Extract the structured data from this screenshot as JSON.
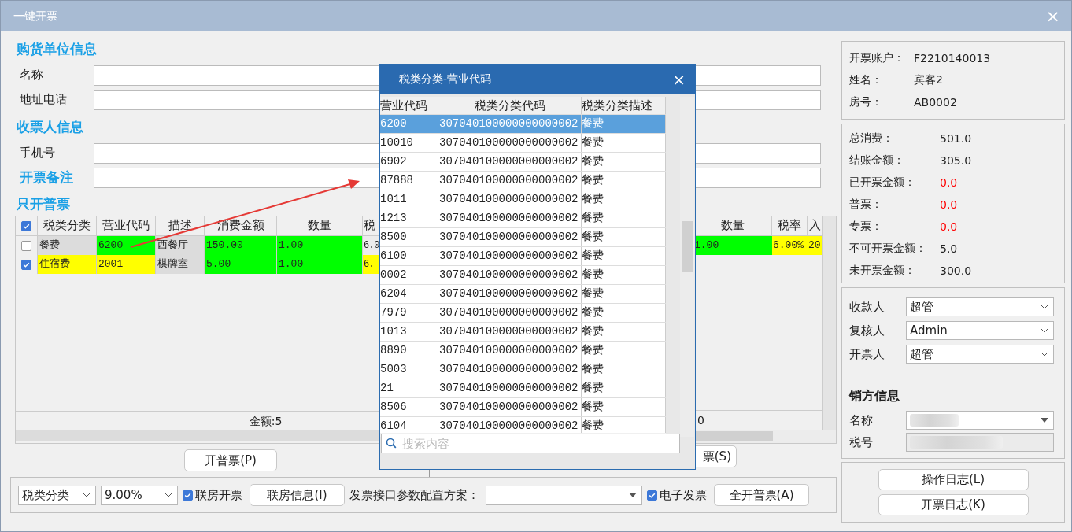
{
  "window": {
    "title": "一键开票",
    "close": "×"
  },
  "buyer": {
    "heading": "购货单位信息",
    "fields": [
      {
        "label": "名称"
      },
      {
        "label": "地址电话"
      }
    ]
  },
  "recipient": {
    "heading": "收票人信息",
    "fields": [
      {
        "label": "手机号"
      }
    ],
    "remark_label": "开票备注"
  },
  "normal_invoice": {
    "heading": "只开普票",
    "header_checked": true,
    "columns": [
      "税类分类",
      "营业代码",
      "描述",
      "消费金额",
      "数量",
      "税"
    ],
    "rows": [
      {
        "checked": false,
        "cells": [
          {
            "text": "餐费",
            "color": "#dcdcdc"
          },
          {
            "text": "6200",
            "color": "#00ff00"
          },
          {
            "text": "西餐厅",
            "color": "#dcdcdc"
          },
          {
            "text": "150.00",
            "color": "#00ff00"
          },
          {
            "text": "1.00",
            "color": "#00ff00"
          },
          {
            "text": "6.0",
            "color": "#ececec"
          }
        ]
      },
      {
        "checked": true,
        "cells": [
          {
            "text": "住宿费",
            "color": "#ffff00"
          },
          {
            "text": "2001",
            "color": "#ffff00"
          },
          {
            "text": "棋牌室",
            "color": "#dcdcdc"
          },
          {
            "text": "5.00",
            "color": "#00ff00"
          },
          {
            "text": "1.00",
            "color": "#00ff00"
          },
          {
            "text": "6.",
            "color": "#ffff00"
          }
        ]
      }
    ],
    "total": "金额:5",
    "button": "开普票(P)"
  },
  "special_invoice": {
    "columns": [
      "数量",
      "税率",
      "入"
    ],
    "rows": [
      {
        "cells": [
          {
            "text": "1.00",
            "color": "#00ff00"
          },
          {
            "text": "6.00%",
            "color": "#ffff00"
          },
          {
            "text": "20",
            "color": "#ffff00"
          }
        ]
      }
    ],
    "total": "0",
    "button": "票(S)"
  },
  "toolbar": {
    "category": "税类分类",
    "rate": "9.00%",
    "link_room": {
      "label": "联房开票",
      "checked": true
    },
    "link_info_button": "联房信息(I)",
    "scheme_label": "发票接口参数配置方案：",
    "electronic": {
      "label": "电子发票",
      "checked": true
    },
    "all_button": "全开普票(A)"
  },
  "account": [
    {
      "label": "开票账户：",
      "value": "F2210140013"
    },
    {
      "label": "姓名：",
      "value": "宾客2"
    },
    {
      "label": "房号：",
      "value": "AB0002"
    }
  ],
  "totals": [
    {
      "label": "总消费：",
      "value": "501.0",
      "kind": "normal"
    },
    {
      "label": "结账金额：",
      "value": "305.0",
      "kind": "normal"
    },
    {
      "label": "已开票金额：",
      "value": "0.0",
      "kind": "alert"
    },
    {
      "label": "普票：",
      "value": "0.0",
      "kind": "alert"
    },
    {
      "label": "专票：",
      "value": "0.0",
      "kind": "alert"
    },
    {
      "label": "不可开票金额：",
      "value": "5.0",
      "kind": "normal"
    },
    {
      "label": "未开票金额：",
      "value": "300.0",
      "kind": "normal"
    }
  ],
  "signers": [
    {
      "label": "收款人",
      "value": "超管"
    },
    {
      "label": "复核人",
      "value": "Admin"
    },
    {
      "label": "开票人",
      "value": "超管"
    }
  ],
  "seller": {
    "heading": "销方信息",
    "fields": [
      {
        "label": "名称",
        "kind": "dropdown"
      },
      {
        "label": "税号",
        "kind": "readonly"
      }
    ]
  },
  "log_buttons": [
    "操作日志(L)",
    "开票日志(K)"
  ],
  "dialog": {
    "title": "税类分类-营业代码",
    "close": "×",
    "columns": [
      "营业代码",
      "税类分类代码",
      "税类分类描述"
    ],
    "rows": [
      {
        "code": "6200",
        "tax_code": "307040100000000000002",
        "desc": "餐费",
        "selected": true
      },
      {
        "code": "10010",
        "tax_code": "307040100000000000002",
        "desc": "餐费",
        "selected": false
      },
      {
        "code": "6902",
        "tax_code": "307040100000000000002",
        "desc": "餐费",
        "selected": false
      },
      {
        "code": "87888",
        "tax_code": "307040100000000000002",
        "desc": "餐费",
        "selected": false
      },
      {
        "code": "1011",
        "tax_code": "307040100000000000002",
        "desc": "餐费",
        "selected": false
      },
      {
        "code": "1213",
        "tax_code": "307040100000000000002",
        "desc": "餐费",
        "selected": false
      },
      {
        "code": "8500",
        "tax_code": "307040100000000000002",
        "desc": "餐费",
        "selected": false
      },
      {
        "code": "6100",
        "tax_code": "307040100000000000002",
        "desc": "餐费",
        "selected": false
      },
      {
        "code": "0002",
        "tax_code": "307040100000000000002",
        "desc": "餐费",
        "selected": false
      },
      {
        "code": "6204",
        "tax_code": "307040100000000000002",
        "desc": "餐费",
        "selected": false
      },
      {
        "code": "7979",
        "tax_code": "307040100000000000002",
        "desc": "餐费",
        "selected": false
      },
      {
        "code": "1013",
        "tax_code": "307040100000000000002",
        "desc": "餐费",
        "selected": false
      },
      {
        "code": "8890",
        "tax_code": "307040100000000000002",
        "desc": "餐费",
        "selected": false
      },
      {
        "code": "5003",
        "tax_code": "307040100000000000002",
        "desc": "餐费",
        "selected": false
      },
      {
        "code": "21",
        "tax_code": "307040100000000000002",
        "desc": "餐费",
        "selected": false
      },
      {
        "code": "8506",
        "tax_code": "307040100000000000002",
        "desc": "餐费",
        "selected": false
      },
      {
        "code": "6104",
        "tax_code": "307040100000000000002",
        "desc": "餐费",
        "selected": false
      }
    ],
    "search_placeholder": "搜索内容"
  }
}
